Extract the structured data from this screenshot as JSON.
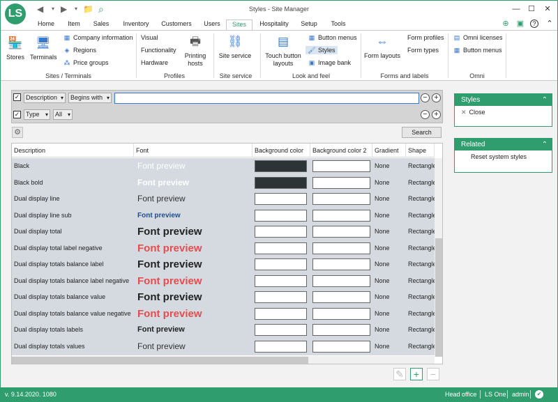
{
  "window": {
    "title": "Styles - Site Manager",
    "logo": "LS",
    "minimize": "—",
    "maximize": "☐",
    "close": "✕"
  },
  "quick_access": {
    "back": "◀",
    "forward": "▶",
    "menu": "▾",
    "folder": "📁",
    "search": "⌕"
  },
  "tabs": [
    "Home",
    "Item",
    "Sales",
    "Inventory",
    "Customers",
    "Users",
    "Sites",
    "Hospitality",
    "Setup",
    "Tools"
  ],
  "active_tab": "Sites",
  "ribbon_right": {
    "icon1": "⊕",
    "icon2": "▣",
    "help": "?",
    "collapse": "⌃"
  },
  "ribbon": {
    "sites_terminals": {
      "stores": "Stores",
      "terminals": "Terminals",
      "company_information": "Company information",
      "regions": "Regions",
      "price_groups": "Price groups",
      "group": "Sites / Terminals"
    },
    "profiles": {
      "visual": "Visual",
      "functionality": "Functionality",
      "hardware": "Hardware",
      "printing_hosts": "Printing hosts",
      "group": "Profiles"
    },
    "site_service": {
      "site_service": "Site service",
      "group": "Site service"
    },
    "look_feel": {
      "touch_button_layouts": "Touch button layouts",
      "button_menus": "Button menus",
      "styles": "Styles",
      "image_bank": "Image bank",
      "group": "Look and feel"
    },
    "forms_labels": {
      "form_layouts": "Form layouts",
      "form_profiles": "Form profiles",
      "form_types": "Form types",
      "group": "Forms and labels"
    },
    "omni": {
      "omni_licenses": "Omni licenses",
      "button_menus": "Button menus",
      "group": "Omni"
    }
  },
  "filter": {
    "row1": {
      "checked": "✓",
      "field": "Description",
      "operator": "Begins with",
      "value": ""
    },
    "row2": {
      "checked": "✓",
      "field": "Type",
      "value": "All"
    },
    "minus": "−",
    "plus": "+"
  },
  "search_button": "Search",
  "grid": {
    "columns": [
      "Description",
      "Font",
      "Background color",
      "Background color 2",
      "Gradient",
      "Shape"
    ],
    "rows": [
      {
        "description": "Black",
        "font_preview": "Font preview",
        "font_color": "#ffffff",
        "font_size": 12,
        "font_weight": "normal",
        "bg": "#2d3436",
        "bg2": "#ffffff",
        "gradient": "None",
        "shape": "Rectangle"
      },
      {
        "description": "Black bold",
        "font_preview": "Font preview",
        "font_color": "#ffffff",
        "font_size": 12,
        "font_weight": "bold",
        "bg": "#2d3436",
        "bg2": "#ffffff",
        "gradient": "None",
        "shape": "Rectangle"
      },
      {
        "description": "Dual display line",
        "font_preview": "Font preview",
        "font_color": "#333333",
        "font_size": 12,
        "font_weight": "normal",
        "bg": "#ffffff",
        "bg2": "#ffffff",
        "gradient": "None",
        "shape": "Rectangle"
      },
      {
        "description": "Dual display line sub",
        "font_preview": "Font preview",
        "font_color": "#1f4e8c",
        "font_size": 10,
        "font_weight": "bold",
        "bg": "#ffffff",
        "bg2": "#ffffff",
        "gradient": "None",
        "shape": "Rectangle"
      },
      {
        "description": "Dual display total",
        "font_preview": "Font preview",
        "font_color": "#222222",
        "font_size": 15,
        "font_weight": "bold",
        "bg": "#ffffff",
        "bg2": "#ffffff",
        "gradient": "None",
        "shape": "Rectangle"
      },
      {
        "description": "Dual display total label negative",
        "font_preview": "Font preview",
        "font_color": "#e74c4c",
        "font_size": 15,
        "font_weight": "bold",
        "bg": "#ffffff",
        "bg2": "#ffffff",
        "gradient": "None",
        "shape": "Rectangle"
      },
      {
        "description": "Dual display totals balance label",
        "font_preview": "Font preview",
        "font_color": "#222222",
        "font_size": 15,
        "font_weight": "bold",
        "bg": "#ffffff",
        "bg2": "#ffffff",
        "gradient": "None",
        "shape": "Rectangle"
      },
      {
        "description": "Dual display totals balance label negative",
        "font_preview": "Font preview",
        "font_color": "#e74c4c",
        "font_size": 15,
        "font_weight": "bold",
        "bg": "#ffffff",
        "bg2": "#ffffff",
        "gradient": "None",
        "shape": "Rectangle"
      },
      {
        "description": "Dual display totals balance value",
        "font_preview": "Font preview",
        "font_color": "#222222",
        "font_size": 15,
        "font_weight": "bold",
        "bg": "#ffffff",
        "bg2": "#ffffff",
        "gradient": "None",
        "shape": "Rectangle"
      },
      {
        "description": "Dual display totals balance value negative",
        "font_preview": "Font preview",
        "font_color": "#e74c4c",
        "font_size": 15,
        "font_weight": "bold",
        "bg": "#ffffff",
        "bg2": "#ffffff",
        "gradient": "None",
        "shape": "Rectangle"
      },
      {
        "description": "Dual display totals labels",
        "font_preview": "Font preview",
        "font_color": "#222222",
        "font_size": 11,
        "font_weight": "bold",
        "bg": "#ffffff",
        "bg2": "#ffffff",
        "gradient": "None",
        "shape": "Rectangle"
      },
      {
        "description": "Dual display totals values",
        "font_preview": "Font preview",
        "font_color": "#333333",
        "font_size": 12,
        "font_weight": "normal",
        "bg": "#ffffff",
        "bg2": "#ffffff",
        "gradient": "None",
        "shape": "Rectangle"
      }
    ]
  },
  "actions": {
    "edit": "✎",
    "add": "+",
    "remove": "−"
  },
  "side_panels": {
    "styles": {
      "title": "Styles",
      "collapse": "⌃",
      "close_icon": "✕",
      "close": "Close"
    },
    "related": {
      "title": "Related",
      "collapse": "⌃",
      "reset": "Reset system styles"
    }
  },
  "status_bar": {
    "version": "v. 9.14.2020. 1080",
    "location": "Head office",
    "product": "LS One",
    "user": "admin",
    "status_icon": "✔"
  }
}
